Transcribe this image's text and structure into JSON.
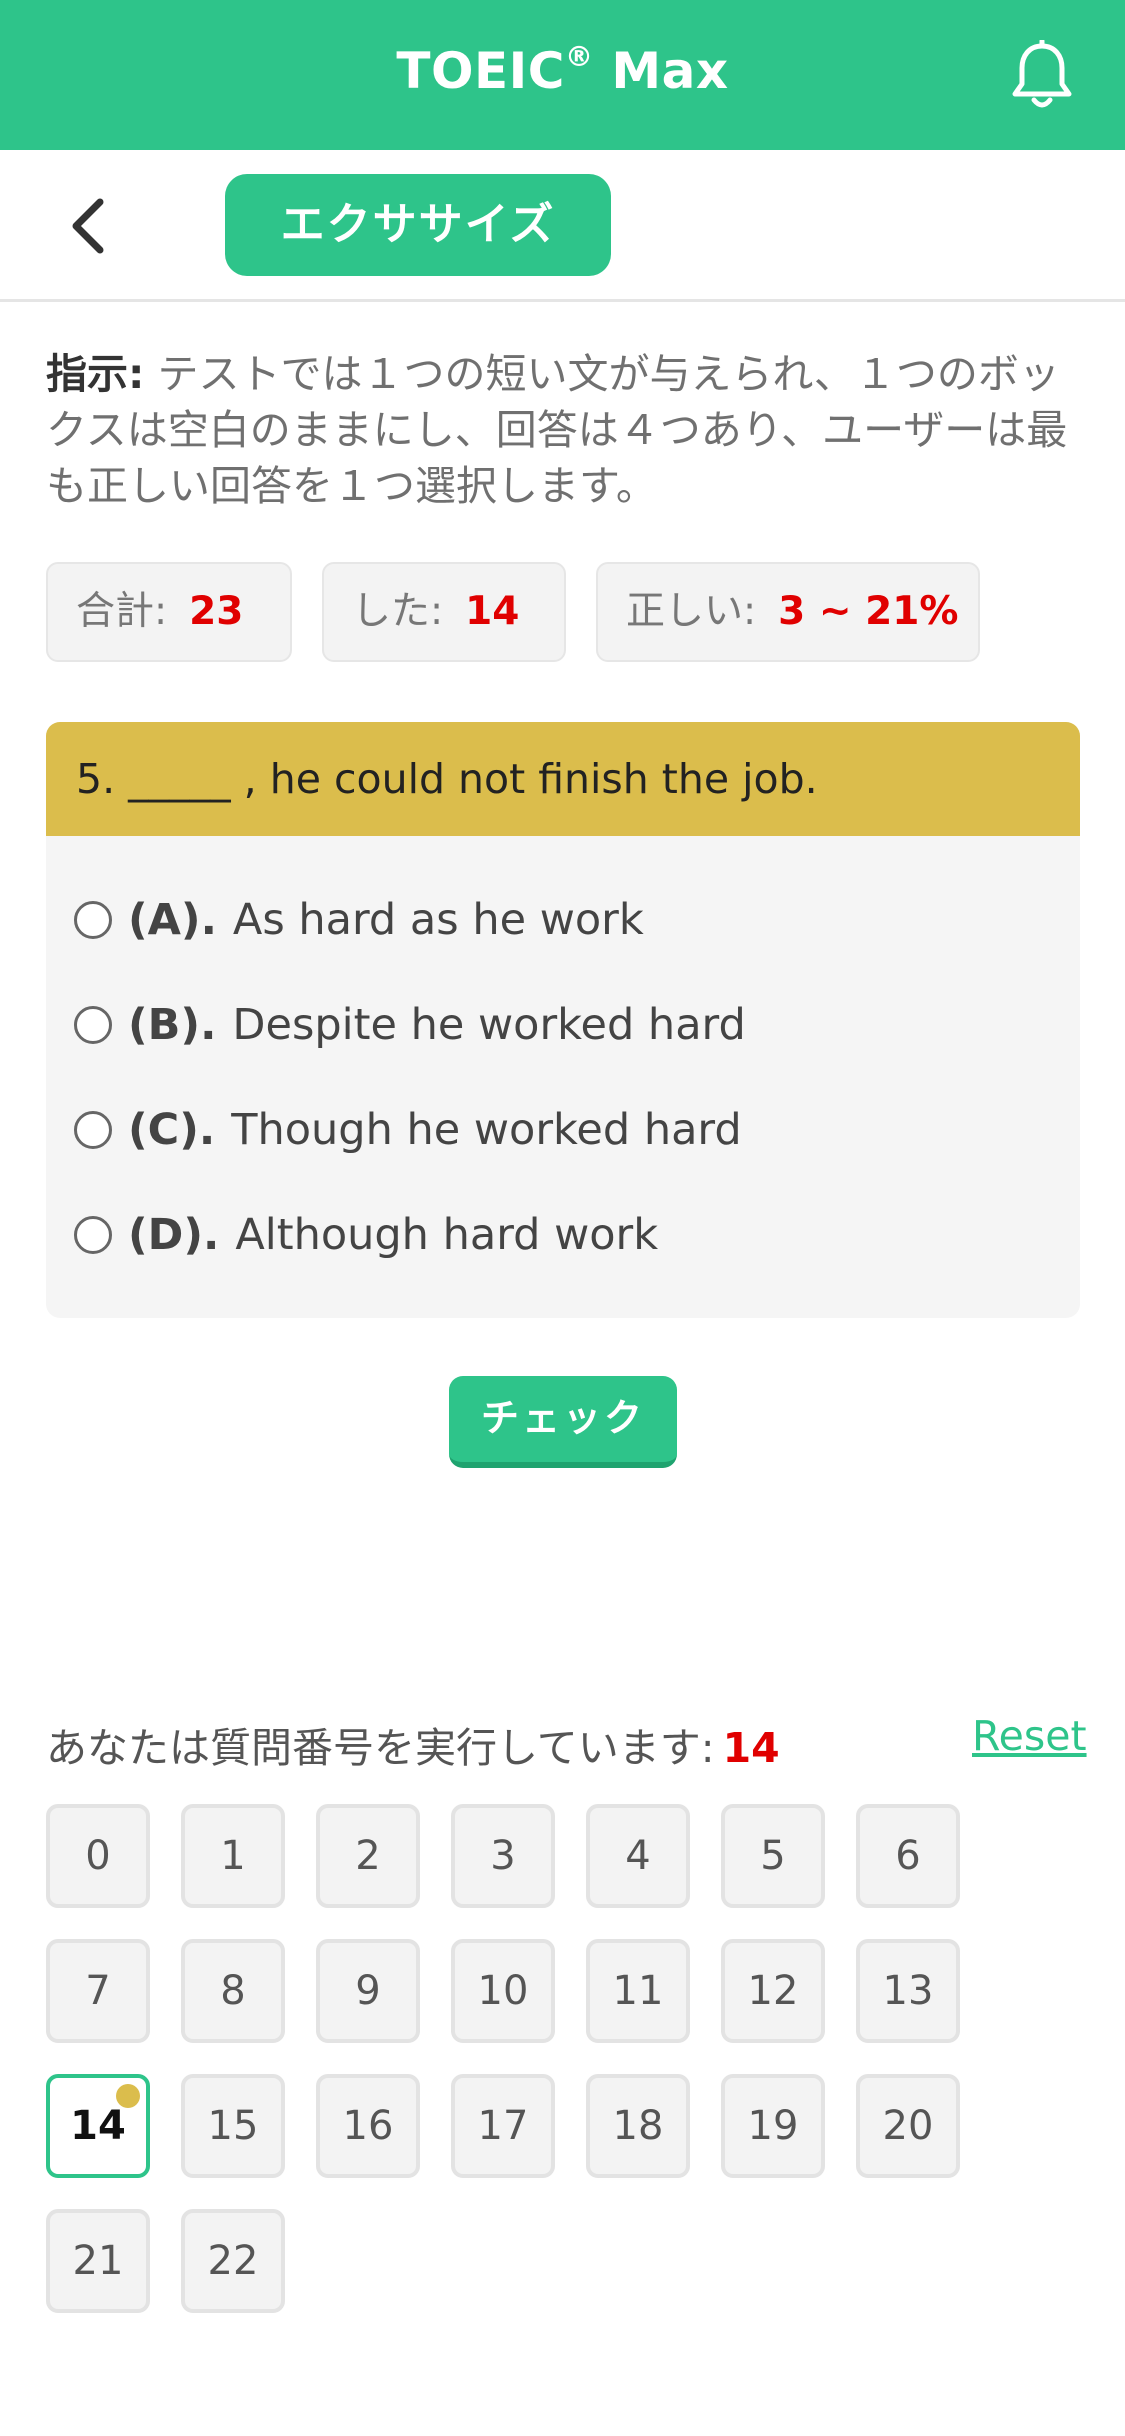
{
  "header": {
    "title": "TOEIC",
    "reg_mark": "®",
    "title_suffix": "Max",
    "bell_icon": "bell-icon",
    "accent_color": "#2ec48a"
  },
  "nav": {
    "back_icon": "chevron-left-icon",
    "exercise_label": "エクササイズ"
  },
  "instructions": {
    "label": "指示:",
    "text": " テストでは１つの短い文が与えられ、１つのボックスは空白のままにし、回答は４つあり、ユーザーは最も正しい回答を１つ選択します。"
  },
  "stats": {
    "total_label": "合計:",
    "total_value": "23",
    "done_label": "した:",
    "done_value": "14",
    "correct_label": "正しい:",
    "correct_value": "3 ~ 21%"
  },
  "question": {
    "text": "5. _____ , he could not finish the job.",
    "options": [
      {
        "letter": "(A).",
        "text": "As hard as he work"
      },
      {
        "letter": "(B).",
        "text": "Despite he worked hard"
      },
      {
        "letter": "(C).",
        "text": "Though he worked hard"
      },
      {
        "letter": "(D).",
        "text": "Although hard work"
      }
    ]
  },
  "check_label": "チェック",
  "progress": {
    "label": "あなたは質問番号を実行しています:",
    "current": "14",
    "reset_label": "Reset"
  },
  "question_numbers": [
    "0",
    "1",
    "2",
    "3",
    "4",
    "5",
    "6",
    "7",
    "8",
    "9",
    "10",
    "11",
    "12",
    "13",
    "14",
    "15",
    "16",
    "17",
    "18",
    "19",
    "20",
    "21",
    "22"
  ]
}
